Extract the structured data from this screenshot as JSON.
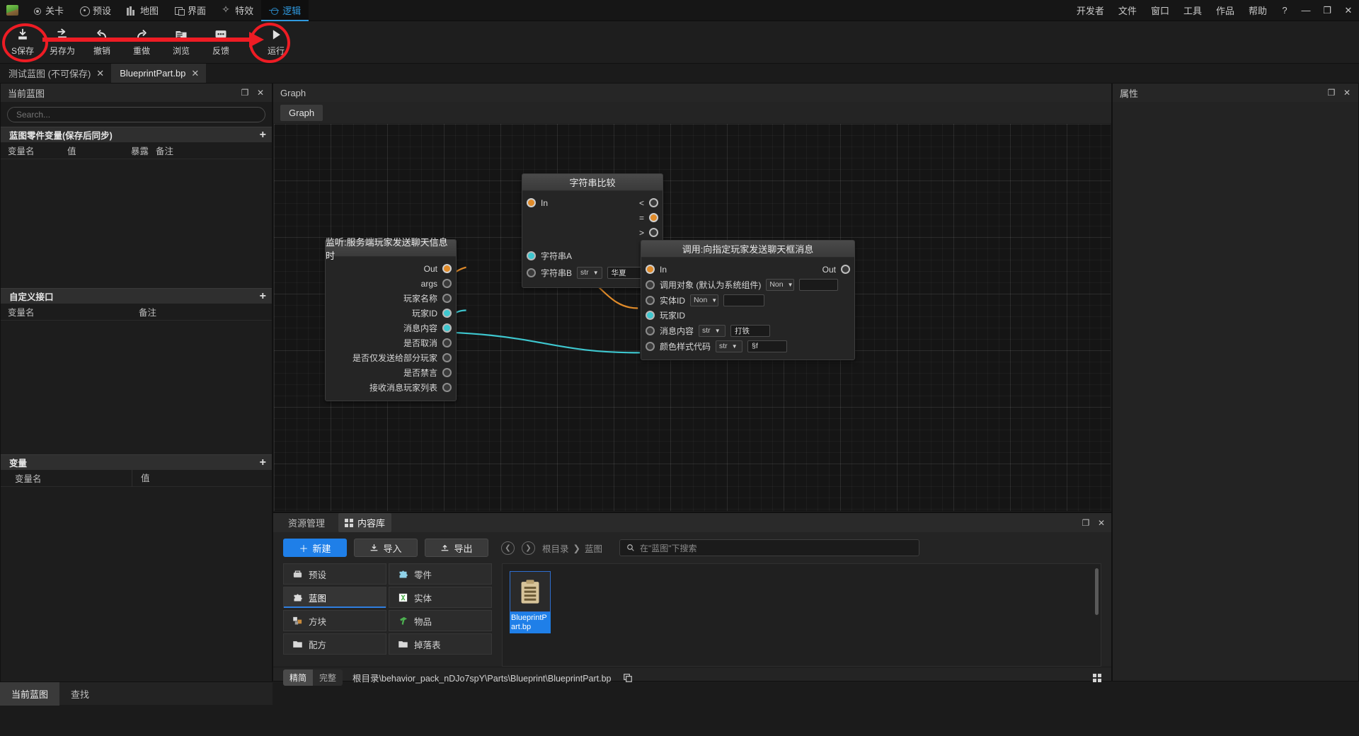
{
  "menubar": {
    "items": [
      {
        "label": "关卡",
        "icon": "target-icon"
      },
      {
        "label": "预设",
        "icon": "circle-dot-icon"
      },
      {
        "label": "地图",
        "icon": "bars-icon"
      },
      {
        "label": "界面",
        "icon": "window-icon"
      },
      {
        "label": "特效",
        "icon": "sparkle-icon"
      },
      {
        "label": "逻辑",
        "icon": "logic-icon"
      }
    ],
    "active": "逻辑",
    "right_items": [
      "开发者",
      "文件",
      "窗口",
      "工具",
      "作品",
      "帮助"
    ],
    "help_glyph": "?",
    "minimize_glyph": "—",
    "maximize_glyph": "❐",
    "close_glyph": "✕"
  },
  "toolbar": {
    "items": [
      {
        "label": "S保存",
        "icon": "save-icon"
      },
      {
        "label": "另存为",
        "icon": "save-as-icon"
      },
      {
        "label": "撤销",
        "icon": "undo-icon"
      },
      {
        "label": "重做",
        "icon": "redo-icon"
      },
      {
        "label": "浏览",
        "icon": "browse-icon"
      },
      {
        "label": "反馈",
        "icon": "feedback-icon"
      },
      {
        "label": "运行",
        "icon": "play-icon"
      }
    ]
  },
  "doc_tabs": [
    {
      "label": "测试蓝图 (不可保存)",
      "close": "✕",
      "active": false
    },
    {
      "label": "BlueprintPart.bp",
      "close": "✕",
      "active": true
    }
  ],
  "left_panel": {
    "title": "当前蓝图",
    "maximize_glyph": "❐",
    "close_glyph": "✕",
    "search_placeholder": "Search...",
    "sections": [
      {
        "title": "蓝图零件变量(保存后同步)",
        "add": "+",
        "columns": [
          "变量名",
          "值",
          "暴露",
          "备注"
        ],
        "rows": []
      },
      {
        "title": "自定义接口",
        "add": "+",
        "columns": [
          "变量名",
          "备注"
        ],
        "rows": []
      },
      {
        "title": "变量",
        "add": "+",
        "columns": [
          "变量名",
          "值"
        ],
        "rows": []
      }
    ],
    "bottom_tabs": [
      {
        "label": "当前蓝图",
        "active": true
      },
      {
        "label": "查找",
        "active": false
      }
    ]
  },
  "graph_panel": {
    "title": "Graph",
    "tab": "Graph",
    "nodes": [
      {
        "id": "listen",
        "title": "监听:服务端玩家发送聊天信息时",
        "outputs": [
          {
            "label": "Out",
            "type": "exec",
            "connected": true
          },
          {
            "label": "args",
            "type": "data",
            "connected": false
          },
          {
            "label": "玩家名称",
            "type": "data",
            "connected": false
          },
          {
            "label": "玩家ID",
            "type": "str",
            "connected": true
          },
          {
            "label": "消息内容",
            "type": "str",
            "connected": true
          },
          {
            "label": "是否取消",
            "type": "data",
            "connected": false
          },
          {
            "label": "是否仅发送给部分玩家",
            "type": "data",
            "connected": false
          },
          {
            "label": "是否禁言",
            "type": "data",
            "connected": false
          },
          {
            "label": "接收消息玩家列表",
            "type": "data",
            "connected": false
          }
        ]
      },
      {
        "id": "strcmp",
        "title": "字符串比较",
        "inputs": [
          {
            "label": "In",
            "type": "exec",
            "connected": true
          },
          {
            "label": "字符串A",
            "type": "str",
            "connected": true
          },
          {
            "label": "字符串B",
            "type": "data",
            "connected": false,
            "select": "str",
            "value": "华夏"
          }
        ],
        "outputs": [
          {
            "label": "<",
            "type": "exec",
            "connected": false
          },
          {
            "label": "=",
            "type": "exec",
            "connected": true
          },
          {
            "label": ">",
            "type": "exec",
            "connected": false
          }
        ]
      },
      {
        "id": "sendmsg",
        "title": "调用:向指定玩家发送聊天框消息",
        "exec_out": {
          "label": "Out",
          "type": "exec",
          "connected": false
        },
        "inputs": [
          {
            "label": "In",
            "type": "exec",
            "connected": true
          },
          {
            "label": "调用对象 (默认为系统组件)",
            "type": "data",
            "connected": false,
            "select": "Non",
            "value": ""
          },
          {
            "label": "实体ID",
            "type": "data",
            "connected": false,
            "select": "Non",
            "value": ""
          },
          {
            "label": "玩家ID",
            "type": "str",
            "connected": true
          },
          {
            "label": "消息内容",
            "type": "data",
            "connected": false,
            "select": "str",
            "value": "打铁"
          },
          {
            "label": "颜色样式代码",
            "type": "data",
            "connected": false,
            "select": "str",
            "value": "§f"
          }
        ]
      }
    ]
  },
  "prop_panel": {
    "title": "属性",
    "maximize_glyph": "❐",
    "close_glyph": "✕"
  },
  "library": {
    "tabs": [
      {
        "label": "资源管理",
        "active": false
      },
      {
        "label": "内容库",
        "active": true,
        "icon": "grid-icon"
      }
    ],
    "maximize_glyph": "❐",
    "close_glyph": "✕",
    "buttons": [
      {
        "label": "新建",
        "icon": "plus-icon",
        "primary": true
      },
      {
        "label": "导入",
        "icon": "import-icon",
        "primary": false
      },
      {
        "label": "导出",
        "icon": "export-icon",
        "primary": false
      }
    ],
    "nav_back": "❮",
    "nav_fwd": "❯",
    "breadcrumb": [
      "根目录",
      "蓝图"
    ],
    "breadcrumb_sep": "❯",
    "search_placeholder": "在\"蓝图\"下搜索",
    "search_icon": "search-icon",
    "categories": [
      {
        "label": "预设",
        "icon": "preset-icon",
        "active": false
      },
      {
        "label": "零件",
        "icon": "part-icon",
        "active": false
      },
      {
        "label": "蓝图",
        "icon": "blueprint-icon",
        "active": true
      },
      {
        "label": "实体",
        "icon": "entity-icon",
        "active": false
      },
      {
        "label": "方块",
        "icon": "block-icon",
        "active": false
      },
      {
        "label": "物品",
        "icon": "item-icon",
        "active": false
      },
      {
        "label": "配方",
        "icon": "recipe-icon",
        "active": false
      },
      {
        "label": "掉落表",
        "icon": "droptable-icon",
        "active": false
      }
    ],
    "files": [
      {
        "name": "BlueprintPart.bp",
        "icon": "clipboard-icon",
        "selected": true
      }
    ],
    "view_modes": [
      {
        "label": "精简",
        "active": true
      },
      {
        "label": "完整",
        "active": false
      }
    ],
    "path": "根目录\\behavior_pack_nDJo7spY\\Parts\\Blueprint\\BlueprintPart.bp",
    "copy_icon": "copy-icon",
    "grid_view_icon": "grid-view-icon"
  },
  "colors": {
    "accent": "#1f7fe8",
    "annotation": "#ee1c24",
    "exec_pin": "#e08b2a",
    "str_pin": "#3ec7cf"
  }
}
